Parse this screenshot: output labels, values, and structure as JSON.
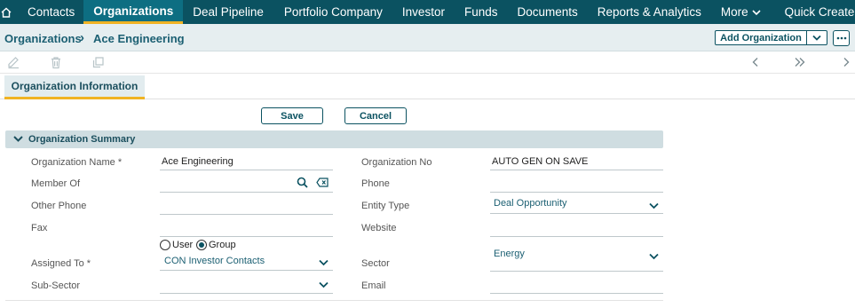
{
  "nav": {
    "items": [
      {
        "label": "Contacts"
      },
      {
        "label": "Organizations"
      },
      {
        "label": "Deal Pipeline"
      },
      {
        "label": "Portfolio Company"
      },
      {
        "label": "Investor"
      },
      {
        "label": "Funds"
      },
      {
        "label": "Documents"
      },
      {
        "label": "Reports & Analytics"
      },
      {
        "label": "More"
      },
      {
        "label": "Quick Create"
      }
    ]
  },
  "breadcrumb": {
    "module": "Organizations",
    "separator": "›",
    "record": "Ace Engineering"
  },
  "header_actions": {
    "add_label": "Add Organization"
  },
  "tabs": [
    {
      "label": "Organization Information"
    }
  ],
  "buttons": {
    "save": "Save",
    "cancel": "Cancel"
  },
  "section": {
    "title": "Organization Summary"
  },
  "form": {
    "org_name_label": "Organization Name *",
    "org_name_value": "Ace Engineering",
    "member_of_label": "Member Of",
    "other_phone_label": "Other Phone",
    "fax_label": "Fax",
    "assigned_to_label": "Assigned To *",
    "assigned_to_value": "CON Investor Contacts",
    "assign_user_label": "User",
    "assign_group_label": "Group",
    "sub_sector_label": "Sub-Sector",
    "org_no_label": "Organization No",
    "org_no_value": "AUTO GEN ON SAVE",
    "phone_label": "Phone",
    "entity_type_label": "Entity Type",
    "entity_type_value": "Deal Opportunity",
    "website_label": "Website",
    "sector_label": "Sector",
    "sector_value": "Energy",
    "email_label": "Email"
  },
  "colors": {
    "nav_bg": "#0b5261",
    "accent": "#f0b323",
    "section_bg": "#cfdde1"
  }
}
